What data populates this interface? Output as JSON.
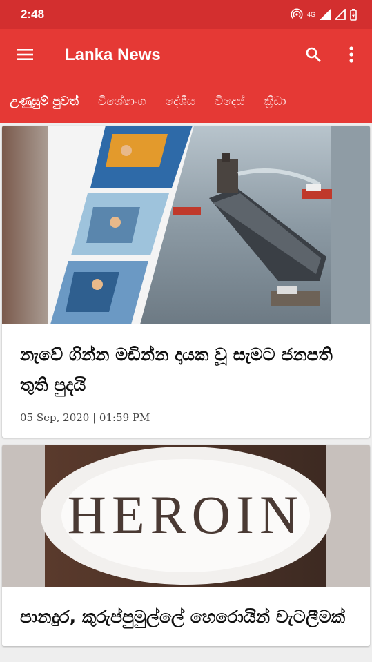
{
  "status_bar": {
    "time": "2:48",
    "network_label": "4G"
  },
  "toolbar": {
    "title": "Lanka News"
  },
  "tabs": [
    {
      "label": "උණුසුම් පුවත්"
    },
    {
      "label": "විශේෂාංග"
    },
    {
      "label": "දේශීය"
    },
    {
      "label": "විදෙස්"
    },
    {
      "label": "ක්‍රීඩා"
    }
  ],
  "articles": [
    {
      "headline": "නැවේ ගින්න මඩින්න දායක වූ සැමට ජනපති තුති පුදයි",
      "date": "05 Sep, 2020 | 01:59 PM"
    },
    {
      "headline": "පානදුර, කුරුප්පුමුල්ලේ හෙරොයින් වැටලීමක්",
      "image_text": "HEROIN"
    }
  ],
  "colors": {
    "status_bar": "#d32f2f",
    "toolbar": "#e53935"
  }
}
